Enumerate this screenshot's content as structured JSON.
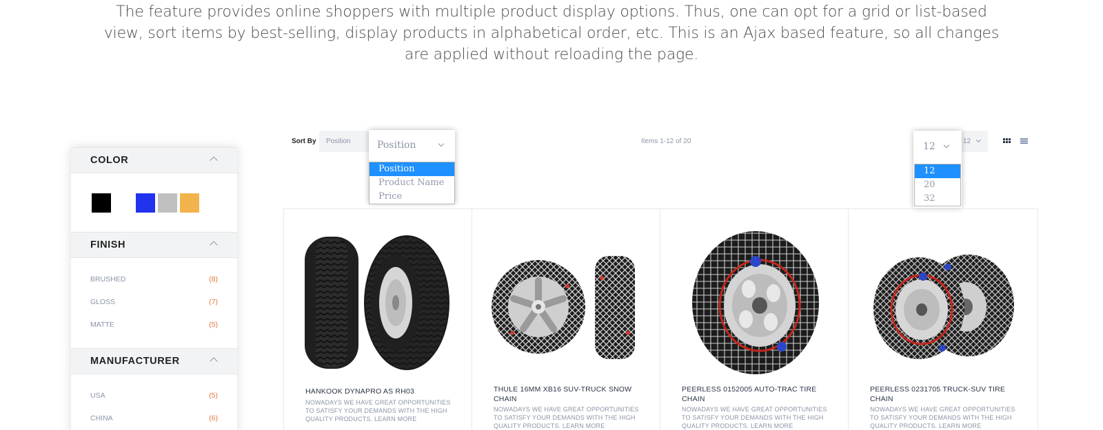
{
  "intro": {
    "text": "The feature provides online shoppers with multiple product display options. Thus, one can opt for a grid or list-based view, sort items by best-selling, display products in alphabetical order, etc. This is an Ajax based feature, so all changes are applied without reloading the page."
  },
  "sidebar": {
    "color": {
      "title": "COLOR",
      "swatches": [
        "#000000",
        "#ffffff",
        "#2233ee",
        "#c0c0c0",
        "#f2b24c"
      ]
    },
    "finish": {
      "title": "FINISH",
      "options": [
        {
          "label": "BRUSHED",
          "count": "(8)"
        },
        {
          "label": "GLOSS",
          "count": "(7)"
        },
        {
          "label": "MATTE",
          "count": "(5)"
        }
      ]
    },
    "manufacturer": {
      "title": "MANUFACTURER",
      "options": [
        {
          "label": "USA",
          "count": "(5)"
        },
        {
          "label": "CHINA",
          "count": "(6)"
        }
      ]
    }
  },
  "toolbar": {
    "sort_label": "Sort By",
    "sort_value": "Position",
    "sort_dropdown": {
      "current": "Position",
      "options": [
        "Position",
        "Product Name",
        "Price"
      ],
      "selected": "Position"
    },
    "items_count": "Items 1-12 of 20",
    "limit_value": "12",
    "limit_dropdown": {
      "current": "12",
      "options": [
        "12",
        "20",
        "32"
      ],
      "selected": "12"
    },
    "accent_color": "#1e90ff",
    "view_icons": [
      "grid-icon",
      "list-icon"
    ]
  },
  "products": [
    {
      "name": "HANKOOK DYNAPRO AS RH03",
      "description": "NOWADAYS WE HAVE GREAT OPPORTUNITIES TO SATISFY YOUR DEMANDS WITH THE HIGH QUALITY PRODUCTS. LEARN MORE"
    },
    {
      "name": "THULE 16MM XB16 SUV-TRUCK SNOW CHAIN",
      "description": "NOWADAYS WE HAVE GREAT OPPORTUNITIES TO SATISFY YOUR DEMANDS WITH THE HIGH QUALITY PRODUCTS. LEARN MORE"
    },
    {
      "name": "PEERLESS 0152005 AUTO-TRAC TIRE CHAIN",
      "description": "NOWADAYS WE HAVE GREAT OPPORTUNITIES TO SATISFY YOUR DEMANDS WITH THE HIGH QUALITY PRODUCTS. LEARN MORE"
    },
    {
      "name": "PEERLESS 0231705 TRUCK-SUV TIRE CHAIN",
      "description": "NOWADAYS WE HAVE GREAT OPPORTUNITIES TO SATISFY YOUR DEMANDS WITH THE HIGH QUALITY PRODUCTS. LEARN MORE"
    }
  ]
}
